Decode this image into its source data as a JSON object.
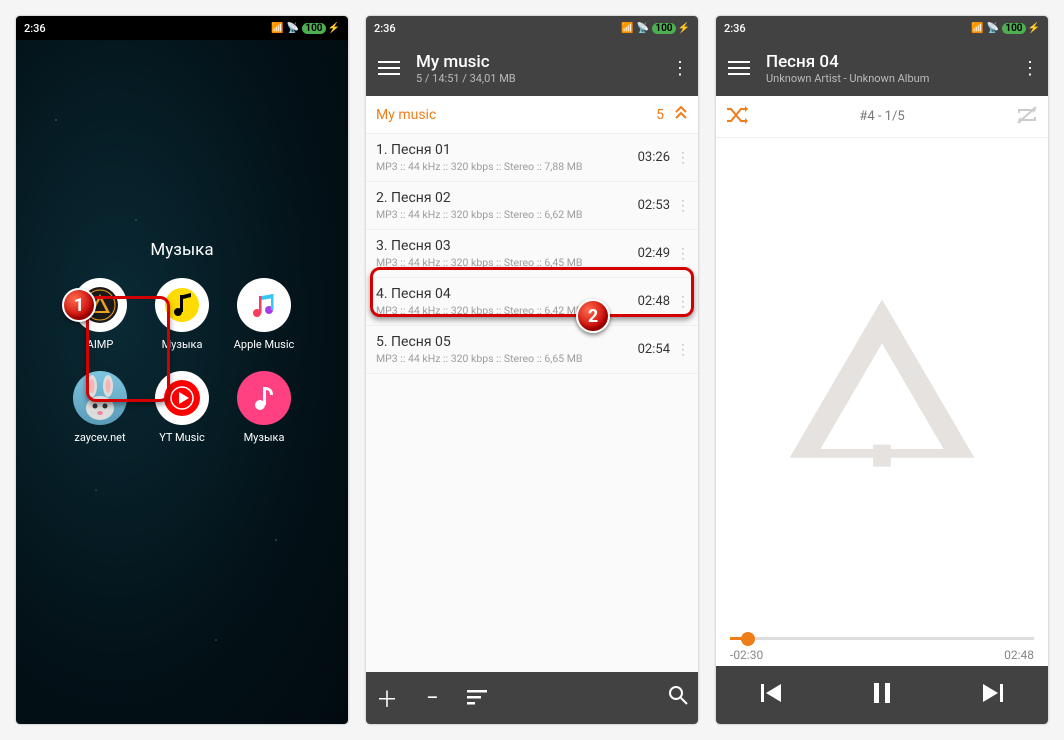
{
  "status": {
    "time": "2:36",
    "battery": "100"
  },
  "home": {
    "folder_title": "Музыка",
    "apps": [
      {
        "label": "AIMP"
      },
      {
        "label": "Музыка"
      },
      {
        "label": "Apple Music"
      },
      {
        "label": "zaycev.net"
      },
      {
        "label": "YT Music"
      },
      {
        "label": "Музыка"
      }
    ],
    "badge1": "1"
  },
  "playlist": {
    "header_title": "My music",
    "header_sub": "5 / 14:51 / 34,01 MB",
    "section_name": "My music",
    "section_count": "5",
    "tracks": [
      {
        "name": "1. Песня 01",
        "meta": "MP3 :: 44 kHz :: 320 kbps :: Stereo :: 7,88 MB",
        "dur": "03:26"
      },
      {
        "name": "2. Песня 02",
        "meta": "MP3 :: 44 kHz :: 320 kbps :: Stereo :: 6,62 MB",
        "dur": "02:53"
      },
      {
        "name": "3. Песня 03",
        "meta": "MP3 :: 44 kHz :: 320 kbps :: Stereo :: 6,45 MB",
        "dur": "02:49"
      },
      {
        "name": "4. Песня 04",
        "meta": "MP3 :: 44 kHz :: 320 kbps :: Stereo :: 6,42 MB",
        "dur": "02:48"
      },
      {
        "name": "5. Песня 05",
        "meta": "MP3 :: 44 kHz :: 320 kbps :: Stereo :: 6,65 MB",
        "dur": "02:54"
      }
    ],
    "badge2": "2"
  },
  "nowplaying": {
    "title": "Песня 04",
    "sub": "Unknown Artist - Unknown Album",
    "counter": "#4   -   1/5",
    "elapsed_neg": "-02:30",
    "total": "02:48"
  }
}
